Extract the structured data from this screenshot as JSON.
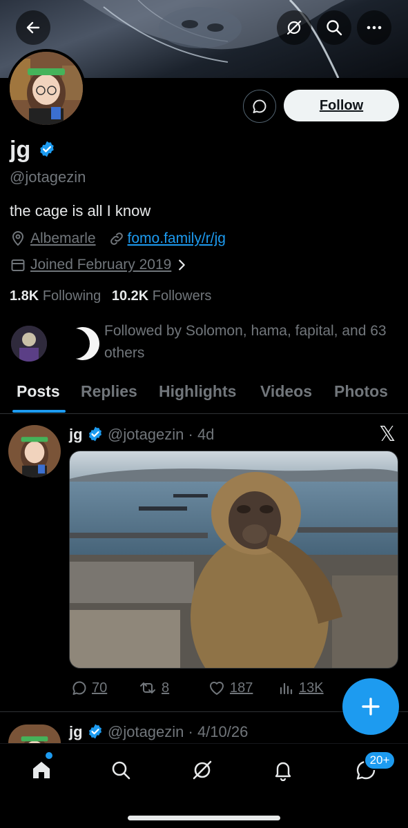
{
  "profile": {
    "name": "jg",
    "handle": "@jotagezin",
    "bio": "the cage is all I know",
    "location": "Albemarle",
    "website": "fomo.family/r/jg",
    "joined": "Joined February 2019",
    "following_count": "1.8K",
    "following_label": "Following",
    "followers_count": "10.2K",
    "followers_label": "Followers",
    "followed_by": "Followed by Solomon, hama, fapital, and 63 others"
  },
  "buttons": {
    "follow": "Follow"
  },
  "tabs": [
    {
      "label": "Posts",
      "active": true
    },
    {
      "label": "Replies"
    },
    {
      "label": "Highlights"
    },
    {
      "label": "Videos"
    },
    {
      "label": "Photos"
    }
  ],
  "posts": [
    {
      "name": "jg",
      "meta": "@jotagezin · 4d",
      "actions": {
        "replies": "70",
        "reposts": "8",
        "likes": "187",
        "views": "13K"
      }
    },
    {
      "name": "jg",
      "meta": "@jotagezin · 4/10/26"
    }
  ],
  "nav": {
    "badge": "20+"
  },
  "icons": {
    "back": "arrow-left-icon",
    "grok": "grok-icon",
    "search": "search-icon",
    "more": "more-icon",
    "message": "message-icon",
    "verified": "verified-badge-icon",
    "location": "location-pin-icon",
    "link": "link-icon",
    "calendar": "calendar-icon",
    "chevron": "chevron-right-icon",
    "x": "x-logo-icon",
    "reply": "reply-icon",
    "repost": "repost-icon",
    "like": "heart-icon",
    "views": "views-icon",
    "compose": "plus-icon",
    "home": "home-icon",
    "notifications": "bell-icon",
    "chat": "chat-icon"
  },
  "colors": {
    "accent": "#1d9bf0",
    "background": "#000000",
    "muted": "#71767b",
    "text": "#e7e9ea"
  }
}
